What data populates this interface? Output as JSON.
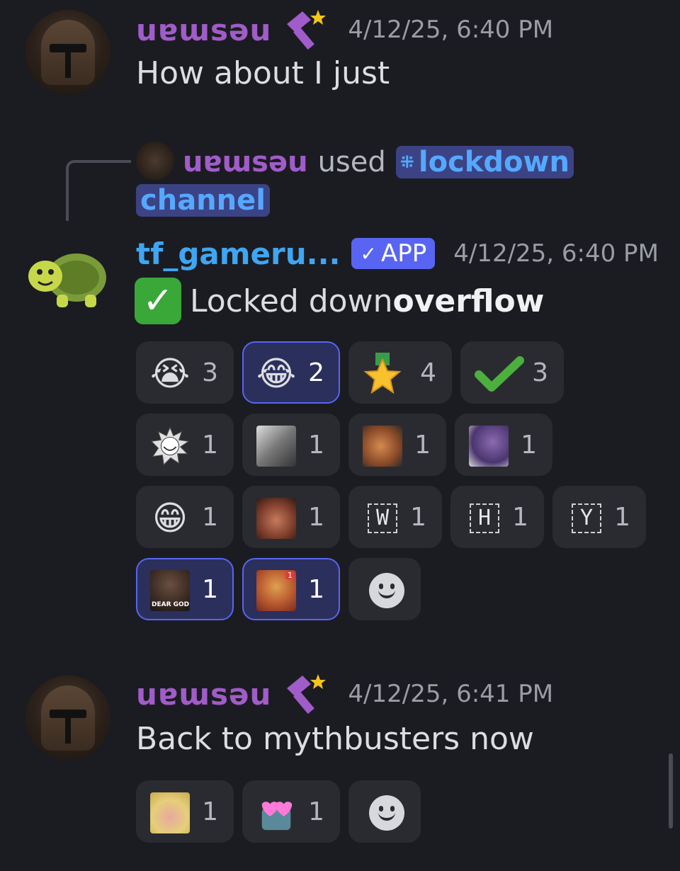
{
  "messages": [
    {
      "username": "uɐɯsəu",
      "timestamp": "4/12/25, 6:40 PM",
      "text": "How about I just"
    },
    {
      "reply": {
        "username": "uɐɯsəu",
        "used": "used",
        "command_line1": "lockdown",
        "command_line2": "channel"
      },
      "username": "tf_gameru...",
      "badge": "APP",
      "timestamp": "4/12/25, 6:40 PM",
      "text_prefix": "Locked down ",
      "text_bold": "overflow",
      "reactions": [
        {
          "emoji": "sob",
          "count": "3",
          "active": false
        },
        {
          "emoji": "joy",
          "count": "2",
          "active": true
        },
        {
          "emoji": "star-medal",
          "count": "4",
          "active": false
        },
        {
          "emoji": "heavy-check",
          "count": "3",
          "active": false
        },
        {
          "emoji": "troll-sun",
          "count": "1",
          "active": false
        },
        {
          "emoji": "photo-man",
          "count": "1",
          "active": false
        },
        {
          "emoji": "tf2-heavy",
          "count": "1",
          "active": false
        },
        {
          "emoji": "thanos-spoon",
          "count": "1",
          "active": false
        },
        {
          "emoji": "grin",
          "count": "1",
          "active": false
        },
        {
          "emoji": "creepy-face",
          "count": "1",
          "active": false
        },
        {
          "emoji": "letter-w",
          "label": "W",
          "count": "1",
          "active": false
        },
        {
          "emoji": "letter-h",
          "label": "H",
          "count": "1",
          "active": false
        },
        {
          "emoji": "letter-y",
          "label": "Y",
          "count": "1",
          "active": false
        },
        {
          "emoji": "dear-god",
          "label": "DEAR GOD",
          "count": "1",
          "active": true
        },
        {
          "emoji": "tf2-engineer",
          "label": "1",
          "count": "1",
          "active": true
        }
      ]
    },
    {
      "username": "uɐɯsəu",
      "timestamp": "4/12/25, 6:41 PM",
      "text": "Back to mythbusters now",
      "reactions": [
        {
          "emoji": "duck-face",
          "count": "1",
          "active": false
        },
        {
          "emoji": "heart-eyes-robot",
          "count": "1",
          "active": false
        }
      ]
    }
  ],
  "colors": {
    "background": "#1b1c21",
    "username_purple": "#a05cc8",
    "app_name_blue": "#3ea6f2",
    "badge": "#5865f2"
  }
}
